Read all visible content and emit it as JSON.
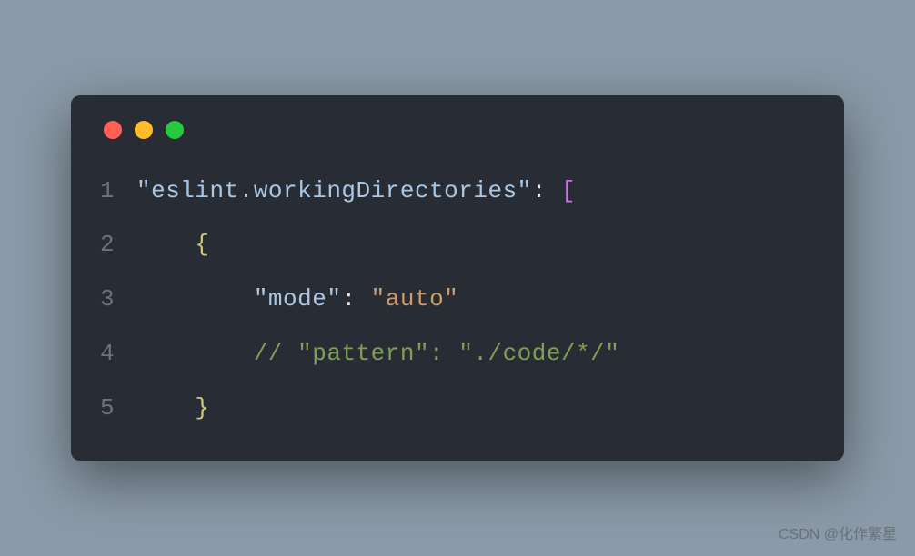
{
  "window": {
    "traffic_lights": [
      "red",
      "yellow",
      "green"
    ]
  },
  "code": {
    "lines": [
      {
        "num": "1"
      },
      {
        "num": "2"
      },
      {
        "num": "3"
      },
      {
        "num": "4"
      },
      {
        "num": "5"
      }
    ],
    "line1": {
      "key": "\"eslint.workingDirectories\"",
      "colon": ": ",
      "bracket": "["
    },
    "line2": {
      "indent": "    ",
      "brace": "{"
    },
    "line3": {
      "indent": "        ",
      "key": "\"mode\"",
      "colon": ": ",
      "value": "\"auto\""
    },
    "line4": {
      "indent": "        ",
      "comment": "// \"pattern\": \"./code/*/\""
    },
    "line5": {
      "indent": "    ",
      "brace": "}"
    }
  },
  "watermark": "CSDN @化作繁星"
}
